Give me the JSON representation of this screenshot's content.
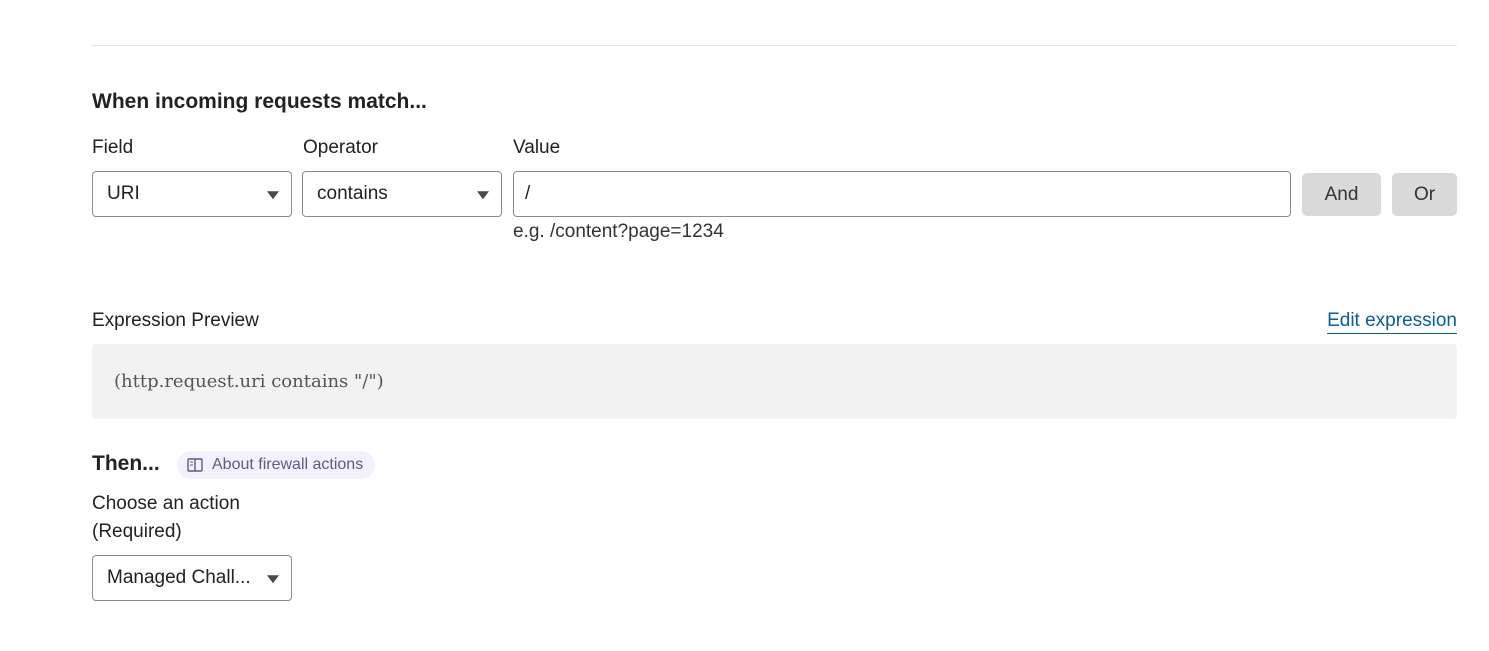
{
  "match": {
    "heading": "When incoming requests match...",
    "field_label": "Field",
    "operator_label": "Operator",
    "value_label": "Value",
    "field_value": "URI",
    "operator_value": "contains",
    "value_input": "/",
    "value_hint": "e.g. /content?page=1234",
    "and_label": "And",
    "or_label": "Or"
  },
  "preview": {
    "label": "Expression Preview",
    "edit_link": "Edit expression",
    "expression": "(http.request.uri contains \"/\")"
  },
  "then": {
    "heading": "Then...",
    "about_link": "About firewall actions",
    "action_label": "Choose an action",
    "required_note": "(Required)",
    "action_value": "Managed Chall..."
  },
  "icons": {
    "dropdown": "caret-down-icon",
    "about": "book-icon"
  },
  "colors": {
    "link": "#0a5e9a",
    "button_bg": "#d9d9d9",
    "preview_bg": "#f2f2f2",
    "pill_bg": "#f3f1fb"
  }
}
